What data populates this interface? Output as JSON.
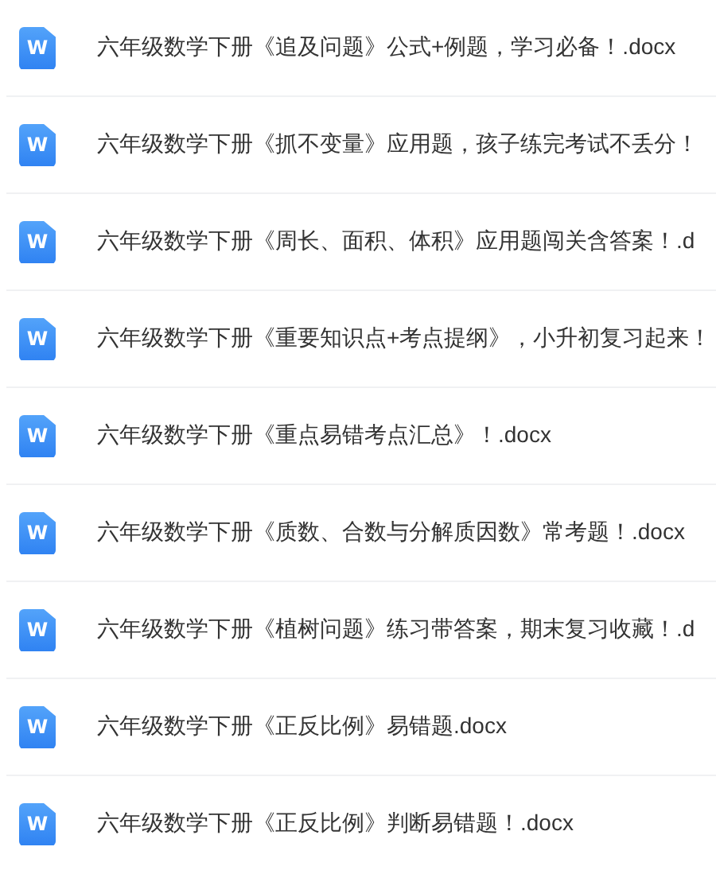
{
  "files": [
    {
      "icon_label": "W",
      "name": "六年级数学下册《追及问题》公式+例题，学习必备！.docx"
    },
    {
      "icon_label": "W",
      "name": "六年级数学下册《抓不变量》应用题，孩子练完考试不丢分！"
    },
    {
      "icon_label": "W",
      "name": "六年级数学下册《周长、面积、体积》应用题闯关含答案！.d"
    },
    {
      "icon_label": "W",
      "name": "六年级数学下册《重要知识点+考点提纲》，小升初复习起来！"
    },
    {
      "icon_label": "W",
      "name": "六年级数学下册《重点易错考点汇总》！.docx"
    },
    {
      "icon_label": "W",
      "name": "六年级数学下册《质数、合数与分解质因数》常考题！.docx"
    },
    {
      "icon_label": "W",
      "name": "六年级数学下册《植树问题》练习带答案，期末复习收藏！.d"
    },
    {
      "icon_label": "W",
      "name": "六年级数学下册《正反比例》易错题.docx"
    },
    {
      "icon_label": "W",
      "name": "六年级数学下册《正反比例》判断易错题！.docx"
    }
  ]
}
